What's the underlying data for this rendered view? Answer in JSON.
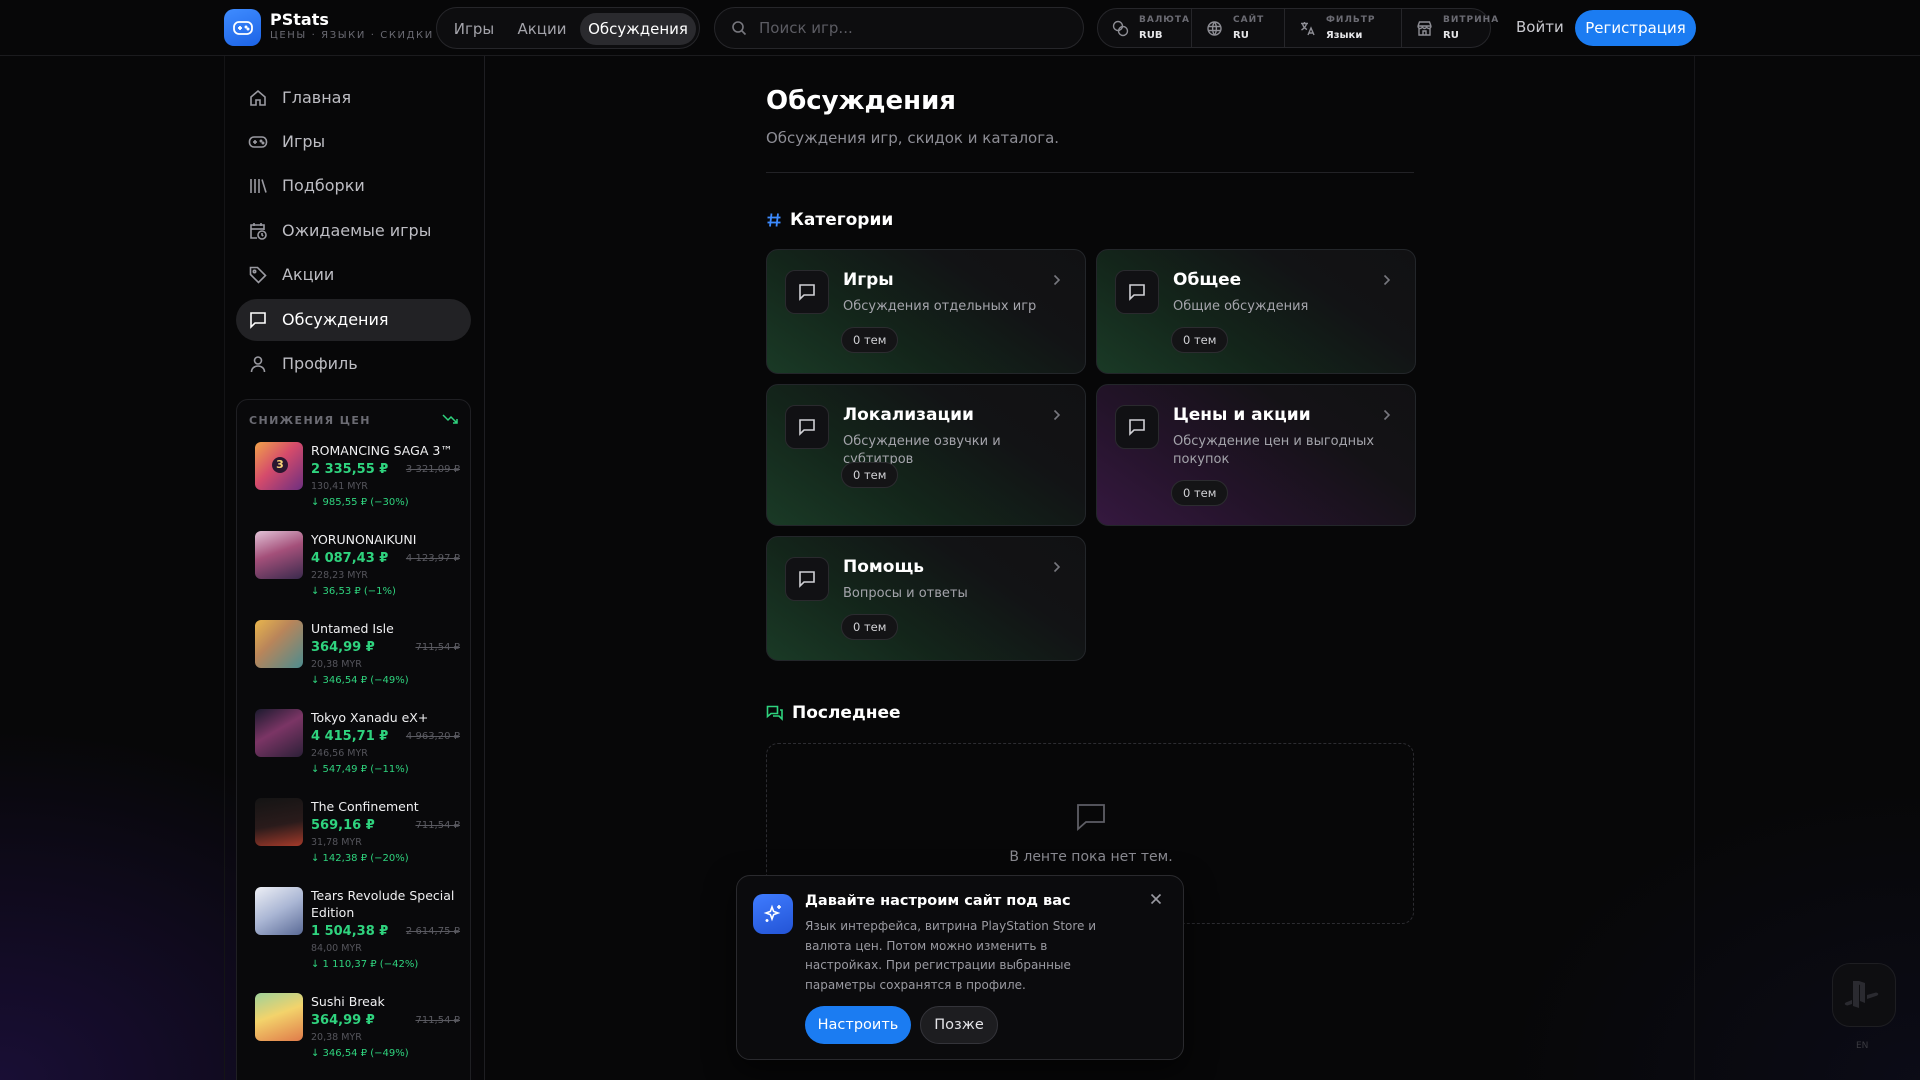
{
  "app": {
    "name": "PStats",
    "tagline": "ЦЕНЫ · ЯЗЫКИ · СКИДКИ"
  },
  "header": {
    "tabs": [
      {
        "label": "Игры"
      },
      {
        "label": "Акции"
      },
      {
        "label": "Обсуждения",
        "active": true
      }
    ],
    "search_placeholder": "Поиск игр...",
    "settings": [
      {
        "label": "ВАЛЮТА",
        "value": "RUB",
        "icon": "coins-icon"
      },
      {
        "label": "САЙТ",
        "value": "RU",
        "icon": "globe-icon"
      },
      {
        "label": "ФИЛЬТР",
        "value": "Языки",
        "icon": "translate-icon"
      },
      {
        "label": "ВИТРИНА",
        "value": "RU",
        "icon": "store-icon"
      }
    ],
    "login_label": "Войти",
    "register_label": "Регистрация"
  },
  "sidebar": {
    "items": [
      {
        "label": "Главная",
        "icon": "home-icon"
      },
      {
        "label": "Игры",
        "icon": "gamepad-icon"
      },
      {
        "label": "Подборки",
        "icon": "library-icon"
      },
      {
        "label": "Ожидаемые игры",
        "icon": "calendar-clock-icon"
      },
      {
        "label": "Акции",
        "icon": "tag-icon"
      },
      {
        "label": "Обсуждения",
        "icon": "chat-icon",
        "active": true
      },
      {
        "label": "Профиль",
        "icon": "user-icon"
      }
    ],
    "drops": {
      "title": "СНИЖЕНИЯ ЦЕН",
      "games": [
        {
          "name": "ROMANCING SAGA 3™",
          "price": "2 335,55 ₽",
          "old": "3 321,09 ₽",
          "myr": "130,41 MYR",
          "diff": "↓ 985,55 ₽ (−30%)"
        },
        {
          "name": "YORUNONAIKUNI",
          "price": "4 087,43 ₽",
          "old": "4 123,97 ₽",
          "myr": "228,23 MYR",
          "diff": "↓ 36,53 ₽ (−1%)"
        },
        {
          "name": "Untamed Isle",
          "price": "364,99 ₽",
          "old": "711,54 ₽",
          "myr": "20,38 MYR",
          "diff": "↓ 346,54 ₽ (−49%)"
        },
        {
          "name": "Tokyo Xanadu eX+",
          "price": "4 415,71 ₽",
          "old": "4 963,20 ₽",
          "myr": "246,56 MYR",
          "diff": "↓ 547,49 ₽ (−11%)"
        },
        {
          "name": "The Confinement",
          "price": "569,16 ₽",
          "old": "711,54 ₽",
          "myr": "31,78 MYR",
          "diff": "↓ 142,38 ₽ (−20%)"
        },
        {
          "name": "Tears Revolude Special Edition",
          "price": "1 504,38 ₽",
          "old": "2 614,75 ₽",
          "myr": "84,00 MYR",
          "diff": "↓ 1 110,37 ₽ (−42%)"
        },
        {
          "name": "Sushi Break",
          "price": "364,99 ₽",
          "old": "711,54 ₽",
          "myr": "20,38 MYR",
          "diff": "↓ 346,54 ₽ (−49%)"
        }
      ]
    }
  },
  "main": {
    "title": "Обсуждения",
    "subtitle": "Обсуждения игр, скидок и каталога.",
    "categories_heading": "Категории",
    "categories": [
      {
        "title": "Игры",
        "desc": "Обсуждения отдельных игр",
        "count": "0 тем",
        "tint": "green"
      },
      {
        "title": "Общее",
        "desc": "Общие обсуждения",
        "count": "0 тем",
        "tint": "green"
      },
      {
        "title": "Локализации",
        "desc": "Обсуждение озвучки и субтитров",
        "count": "0 тем",
        "tint": "green"
      },
      {
        "title": "Цены и акции",
        "desc": "Обсуждение цен и выгодных покупок",
        "count": "0 тем",
        "tint": "purple"
      },
      {
        "title": "Помощь",
        "desc": "Вопросы и ответы",
        "count": "0 тем",
        "tint": "green"
      }
    ],
    "latest_heading": "Последнее",
    "empty_text": "В ленте пока нет тем."
  },
  "modal": {
    "title": "Давайте настроим сайт под вас",
    "text": "Язык интерфейса, витрина PlayStation Store и валюта цен. Потом можно изменить в настройках. При регистрации выбранные параметры сохранятся в профиле.",
    "primary_label": "Настроить",
    "secondary_label": "Позже"
  },
  "fab": {
    "lang": "EN"
  },
  "colors": {
    "accent": "#1b7cf2",
    "price_green": "#2fd37e",
    "background": "#070708"
  }
}
